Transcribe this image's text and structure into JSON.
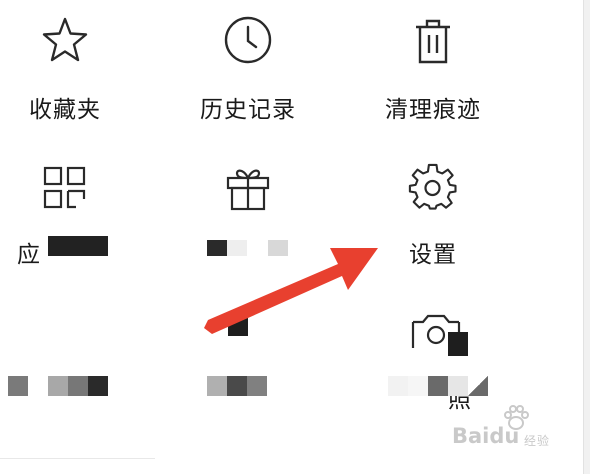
{
  "menu": {
    "items": [
      {
        "id": "favorites",
        "label": "收藏夹",
        "icon": "star-icon"
      },
      {
        "id": "history",
        "label": "历史记录",
        "icon": "clock-icon"
      },
      {
        "id": "clear-traces",
        "label": "清理痕迹",
        "icon": "trash-icon"
      },
      {
        "id": "apps",
        "label": "应",
        "icon": "grid-icon"
      },
      {
        "id": "gift",
        "label": "",
        "icon": "gift-icon"
      },
      {
        "id": "settings",
        "label": "设置",
        "icon": "gear-icon"
      },
      {
        "id": "camera",
        "label": "照",
        "icon": "camera-icon"
      }
    ]
  },
  "watermark": {
    "text": "Baidu",
    "sub": "经验"
  },
  "colors": {
    "arrow": "#e8402f",
    "icon_stroke": "#2a2a2a",
    "text": "#1a1a1a",
    "mosaic_dark": "#222222"
  }
}
